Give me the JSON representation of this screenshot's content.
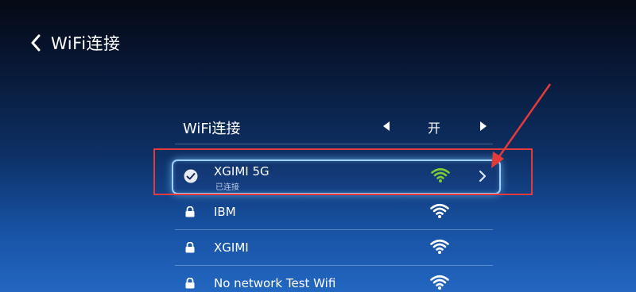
{
  "header": {
    "title": "WiFi连接"
  },
  "wifi_toggle": {
    "label": "WiFi连接",
    "value": "开"
  },
  "networks": [
    {
      "name": "XGIMI 5G",
      "status": "已连接",
      "connected": true,
      "secured": true
    },
    {
      "name": "IBM",
      "status": "",
      "connected": false,
      "secured": true
    },
    {
      "name": "XGIMI",
      "status": "",
      "connected": false,
      "secured": true
    },
    {
      "name": "No network Test Wifi",
      "status": "",
      "connected": false,
      "secured": true
    }
  ],
  "colors": {
    "accent_green": "#7ccc35",
    "highlight_border": "#9fd0ff",
    "annotation_red": "#e53a3a"
  },
  "icons": {
    "back": "chevron-left-icon",
    "check": "check-circle-icon",
    "lock": "lock-icon",
    "wifi": "wifi-signal-icon",
    "detail": "chevron-right-icon"
  }
}
